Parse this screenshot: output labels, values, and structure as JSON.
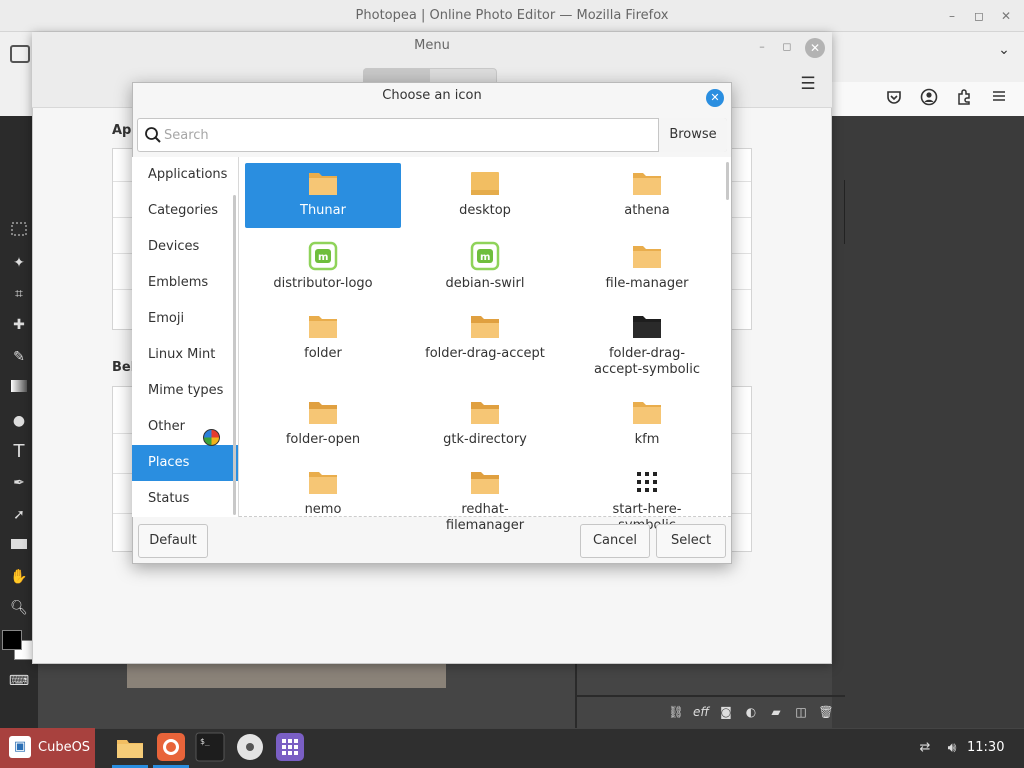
{
  "firefox": {
    "title": "Photopea | Online Photo Editor — Mozilla Firefox",
    "minimize_glyph": "–",
    "maximize_glyph": "◻",
    "close_glyph": "✕",
    "tabs_chevron": "⌄",
    "nav_icons": [
      "pocket-icon",
      "account-icon",
      "extensions-icon",
      "menu-icon"
    ]
  },
  "menu_window": {
    "title": "Menu",
    "section_applications": "App",
    "section_below": "Bel",
    "hamburger_glyph": "☰"
  },
  "dialog": {
    "title": "Choose an icon",
    "close_glyph": "✕",
    "search_placeholder": "Search",
    "browse_label": "Browse",
    "categories": [
      {
        "label": "Applications",
        "selected": false
      },
      {
        "label": "Categories",
        "selected": false
      },
      {
        "label": "Devices",
        "selected": false
      },
      {
        "label": "Emblems",
        "selected": false
      },
      {
        "label": "Emoji",
        "selected": false
      },
      {
        "label": "Linux Mint",
        "selected": false
      },
      {
        "label": "Mime types",
        "selected": false
      },
      {
        "label": "Other",
        "selected": false
      },
      {
        "label": "Places",
        "selected": true
      },
      {
        "label": "Status",
        "selected": false
      }
    ],
    "icons": [
      {
        "label": "Thunar",
        "kind": "folder",
        "selected": true
      },
      {
        "label": "desktop",
        "kind": "folder-flat"
      },
      {
        "label": "athena",
        "kind": "folder"
      },
      {
        "label": "distributor-logo",
        "kind": "mint"
      },
      {
        "label": "debian-swirl",
        "kind": "mint"
      },
      {
        "label": "file-manager",
        "kind": "folder"
      },
      {
        "label": "folder",
        "kind": "folder"
      },
      {
        "label": "folder-drag-accept",
        "kind": "folder-open"
      },
      {
        "label": "folder-drag-accept-symbolic",
        "kind": "folder-dark"
      },
      {
        "label": "folder-open",
        "kind": "folder-open"
      },
      {
        "label": "gtk-directory",
        "kind": "folder-open"
      },
      {
        "label": "kfm",
        "kind": "folder"
      },
      {
        "label": "nemo",
        "kind": "folder"
      },
      {
        "label": "redhat-filemanager",
        "kind": "folder-open"
      },
      {
        "label": "start-here-symbolic",
        "kind": "dots"
      }
    ],
    "default_label": "Default",
    "cancel_label": "Cancel",
    "select_label": "Select"
  },
  "taskbar": {
    "start_label": "CubeOS",
    "clock": "11:30",
    "apps": [
      "files-icon",
      "firefox-icon",
      "terminal-icon",
      "disc-icon",
      "app-grid-icon"
    ]
  },
  "colors": {
    "accent": "#2a8ee0",
    "folder": "#f2be62",
    "start": "#a8413e"
  }
}
